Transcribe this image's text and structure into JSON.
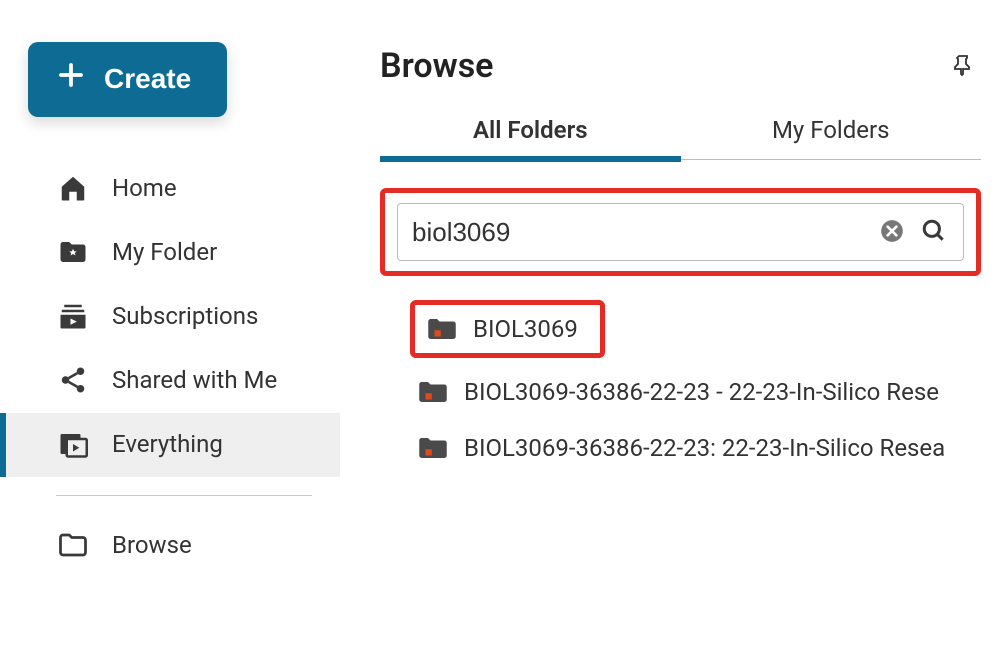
{
  "sidebar": {
    "create_label": "Create",
    "items": [
      {
        "label": "Home"
      },
      {
        "label": "My Folder"
      },
      {
        "label": "Subscriptions"
      },
      {
        "label": "Shared with Me"
      },
      {
        "label": "Everything"
      },
      {
        "label": "Browse"
      }
    ]
  },
  "main": {
    "title": "Browse",
    "tabs": {
      "all": "All Folders",
      "my": "My Folders"
    },
    "search": {
      "value": "biol3069"
    },
    "results": [
      {
        "label": "BIOL3069"
      },
      {
        "label": "BIOL3069-36386-22-23 - 22-23-In-Silico Rese"
      },
      {
        "label": "BIOL3069-36386-22-23: 22-23-In-Silico Resea"
      }
    ]
  }
}
